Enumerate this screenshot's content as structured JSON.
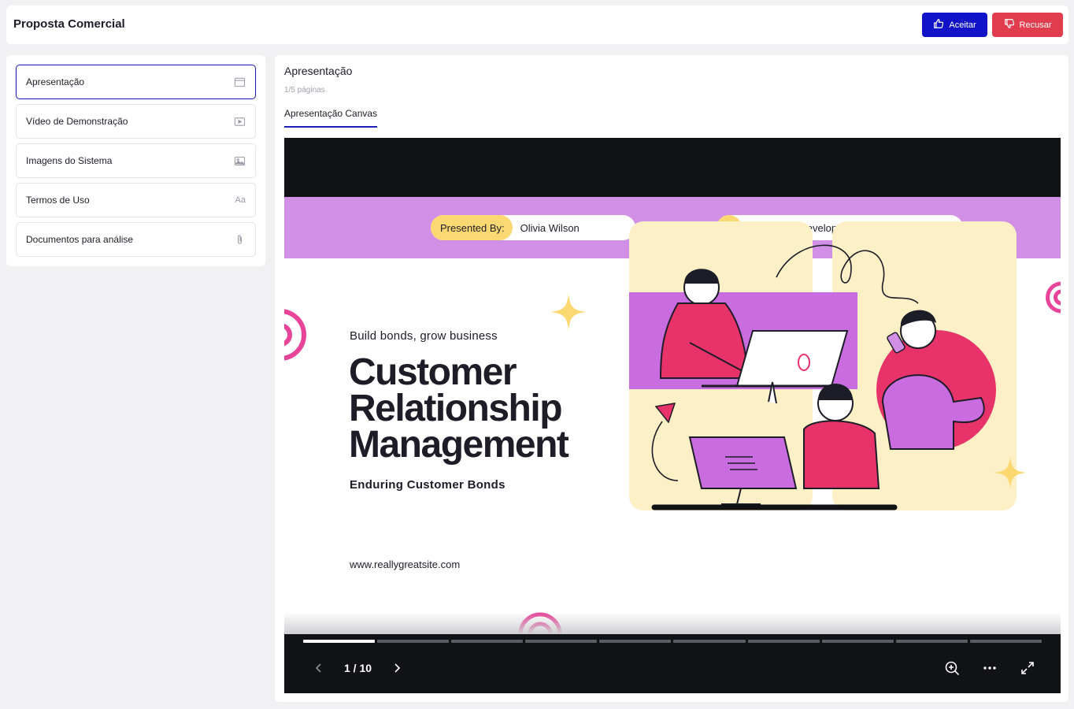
{
  "header": {
    "title": "Proposta Comercial",
    "accept_label": "Aceitar",
    "reject_label": "Recusar"
  },
  "sidebar": {
    "items": [
      {
        "label": "Apresentação",
        "icon": "window-icon",
        "active": true
      },
      {
        "label": "Vídeo de Demonstração",
        "icon": "video-icon",
        "active": false
      },
      {
        "label": "Imagens do Sistema",
        "icon": "image-icon",
        "active": false
      },
      {
        "label": "Termos de Uso",
        "icon": "text-aa-icon",
        "icon_text": "Aa",
        "active": false
      },
      {
        "label": "Documentos para análise",
        "icon": "paperclip-icon",
        "active": false
      }
    ]
  },
  "main": {
    "section_title": "Apresentação",
    "page_count": "1/5 páginas",
    "tab_label": "Apresentação Canvas"
  },
  "slide": {
    "presented_by_label": "Presented By:",
    "presenter": "Olivia Wilson",
    "presentation_type": "Business Development Presentation",
    "subtitle": "Build bonds, grow business",
    "headline_1": "Customer",
    "headline_2": "Relationship",
    "headline_3": "Management",
    "tagline": "Enduring Customer Bonds",
    "website": "www.reallygreatsite.com"
  },
  "viewer": {
    "pager": "1 / 10",
    "current_page": 1,
    "total_pages": 10
  },
  "colors": {
    "accent": "#1113c9",
    "reject": "#e23c4f",
    "band": "#d190e6",
    "yellow": "#fcd872",
    "pink": "#e8336a",
    "purple": "#c86ce0"
  }
}
